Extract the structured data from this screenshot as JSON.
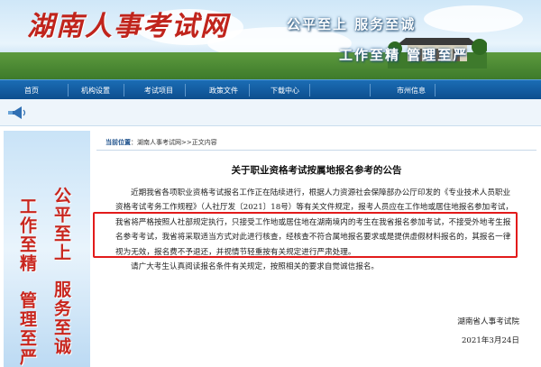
{
  "header": {
    "site_title": "湖南人事考试网",
    "slogan_top": "公平至上  服务至诚",
    "slogan_bottom": "工作至精  管理至严"
  },
  "nav": {
    "items": [
      "首页",
      "机构设置",
      "考试项目",
      "政策文件",
      "下载中心",
      "",
      "市州信息"
    ]
  },
  "sidebar_ad": {
    "col1": "公平至上",
    "col2": "工作至精",
    "col3": "服务至诚",
    "col4": "管理至严"
  },
  "breadcrumb": {
    "label": "当前位置",
    "path": "湖南人事考试网>>正文内容"
  },
  "article": {
    "title": "关于职业资格考试按属地报名参考的公告",
    "paragraphs": [
      "近期我省各项职业资格考试报名工作正在陆续进行，根据人力资源社会保障部办公厅印发的《专业技术人员职业资格考试考务工作规程》（人社厅发〔2021〕18号）等有关文件规定，报考人员应在工作地或居住地报名参加考试，我省将严格按照人社部规定执行，只接受工作地或居住地在湖南境内的考生在我省报名参加考试，不接受外地考生报名参考考试，我省将采取适当方式对此进行核查，经核查不符合属地报名要求或是提供虚假材料报名的，其报名一律视为无效，报名费不予退还，并视情节轻重按有关规定进行严肃处理。",
      "请广大考生认真阅读报名条件有关规定，按照相关的要求自觉诚信报名。"
    ],
    "signature_org": "湖南省人事考试院",
    "signature_date": "2021年3月24日"
  },
  "colors": {
    "nav_bg": "#1b6db5",
    "title_red": "#c0241c",
    "highlight_border": "#e21b1b"
  }
}
